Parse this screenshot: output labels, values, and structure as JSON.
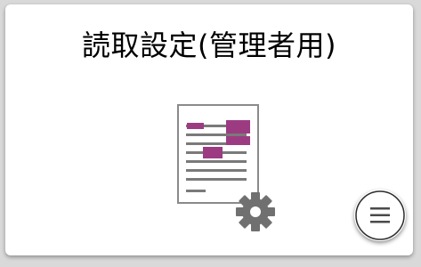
{
  "tile": {
    "title": "読取設定(管理者用)",
    "icon": "document-settings-icon"
  },
  "menu_button": {
    "icon": "hamburger-menu-icon"
  },
  "colors": {
    "accent": "#9c3b82",
    "icon_gray": "#7a7a7a",
    "gear": "#707070"
  }
}
